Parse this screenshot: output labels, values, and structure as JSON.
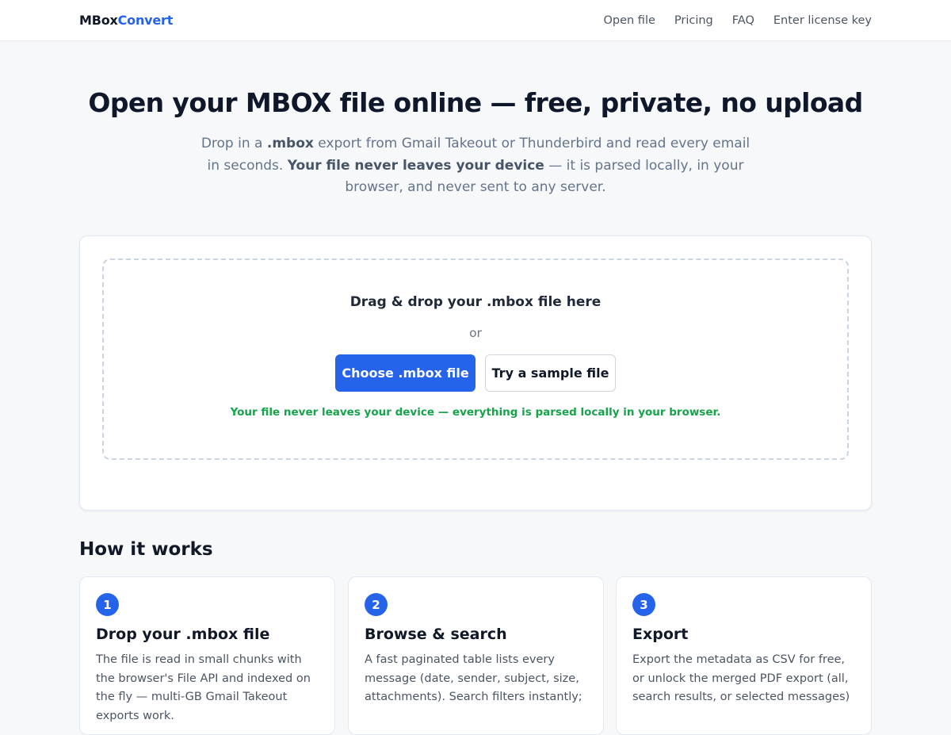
{
  "header": {
    "logo_part1": "MBox",
    "logo_part2": "Convert",
    "nav": [
      "Open file",
      "Pricing",
      "FAQ",
      "Enter license key"
    ]
  },
  "hero": {
    "title": "Open your MBOX file online — free, private, no upload",
    "sub": {
      "t1": "Drop in a ",
      "b1": ".mbox",
      "t2": " export from Gmail Takeout or Thunderbird and read every email in seconds. ",
      "b2": "Your file never leaves your device",
      "t3": " — it is parsed locally, in your browser, and never sent to any server."
    }
  },
  "dropzone": {
    "title": "Drag & drop your .mbox file here",
    "or": "or",
    "choose_button": "Choose .mbox file",
    "sample_button": "Try a sample file",
    "note": "Your file never leaves your device — everything is parsed locally in your browser."
  },
  "how": {
    "heading": "How it works",
    "steps": [
      {
        "num": "1",
        "title": "Drop your .mbox file",
        "text": "The file is read in small chunks with the browser's File API and indexed on the fly — multi-GB Gmail Takeout exports work."
      },
      {
        "num": "2",
        "title": "Browse & search",
        "text": "A fast paginated table lists every message (date, sender, subject, size, attachments). Search filters instantly;"
      },
      {
        "num": "3",
        "title": "Export",
        "text": "Export the metadata as CSV for free, or unlock the merged PDF export (all, search results, or selected messages)"
      }
    ]
  },
  "colors": {
    "accent": "#2563eb",
    "success": "#16a34a",
    "background": "#f7f8fa"
  }
}
